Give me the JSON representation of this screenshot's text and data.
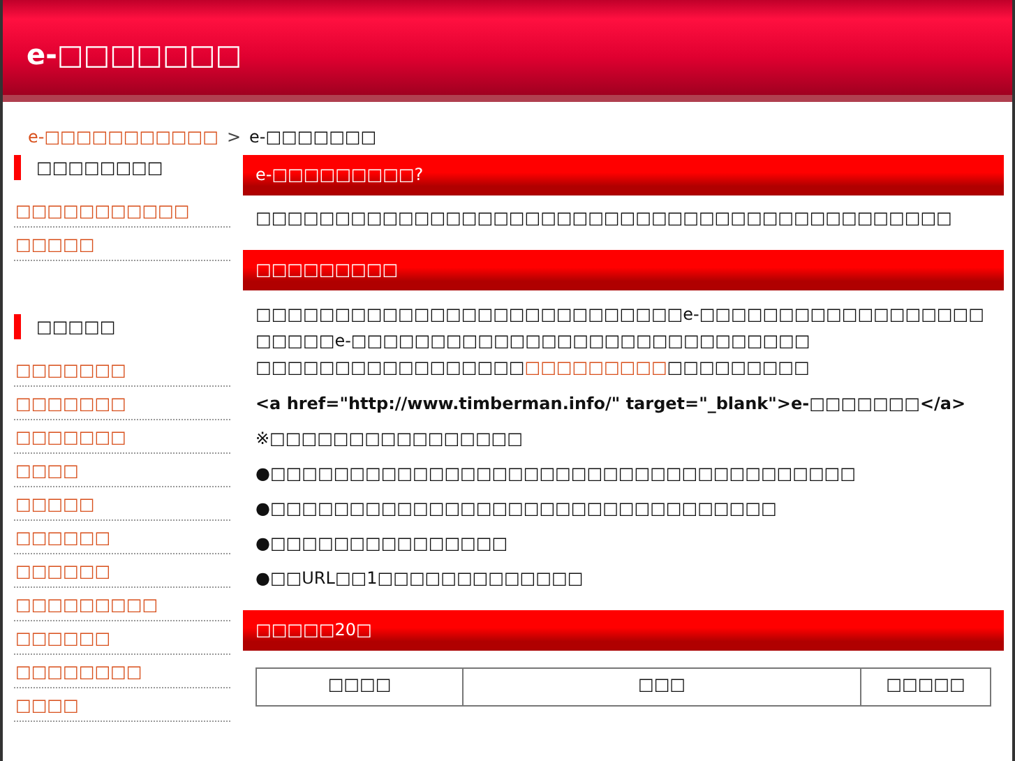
{
  "header": {
    "title": "e-□□□□□□□"
  },
  "breadcrumb": {
    "link": "e-□□□□□□□□□□□",
    "separator": ">",
    "current": "e-□□□□□□□"
  },
  "sidebar": [
    {
      "heading": "□□□□□□□□",
      "items": [
        "□□□□□□□□□□□",
        "□□□□□"
      ]
    },
    {
      "heading": "□□□□□",
      "items": [
        "□□□□□□□",
        "□□□□□□□",
        "□□□□□□□",
        "□□□□",
        "□□□□□",
        "□□□□□□",
        "□□□□□□",
        "□□□□□□□□□",
        "□□□□□□",
        "□□□□□□□□",
        "□□□□"
      ]
    }
  ],
  "sections": [
    {
      "heading": "e-□□□□□□□□□?",
      "blocks": [
        {
          "kind": "text",
          "text": "□□□□□□□□□□□□□□□□□□□□□□□□□□□□□□□□□□□□□□□□□□□□"
        }
      ]
    },
    {
      "heading": "□□□□□□□□□",
      "blocks": [
        {
          "kind": "lines",
          "lines": [
            {
              "before": "□□□□□□□□□□□□□□□□□□□□□□□□□□□e-□□□□□□□□□□□□□□□□□□"
            },
            {
              "before": "□□□□□e-□□□□□□□□□□□□□□□□□□□□□□□□□□□□□"
            },
            {
              "before": "□□□□□□□□□□□□□□□□□",
              "link": "□□□□□□□□□",
              "after": "□□□□□□□□□"
            }
          ]
        },
        {
          "kind": "code",
          "text": "<a href=\"http://www.timberman.info/\" target=\"_blank\">e-□□□□□□□</a>"
        },
        {
          "kind": "text",
          "text": "※□□□□□□□□□□□□□□□□"
        },
        {
          "kind": "text",
          "text": "●□□□□□□□□□□□□□□□□□□□□□□□□□□□□□□□□□□□□□"
        },
        {
          "kind": "text",
          "text": "●□□□□□□□□□□□□□□□□□□□□□□□□□□□□□□□□"
        },
        {
          "kind": "text",
          "text": "●□□□□□□□□□□□□□□□"
        },
        {
          "kind": "text",
          "text": "●□□URL□□1□□□□□□□□□□□□□"
        }
      ]
    },
    {
      "heading": "□□□□□20□",
      "blocks": [
        {
          "kind": "table",
          "columns": [
            "□□□□",
            "□□□",
            "□□□□□"
          ]
        }
      ]
    }
  ]
}
